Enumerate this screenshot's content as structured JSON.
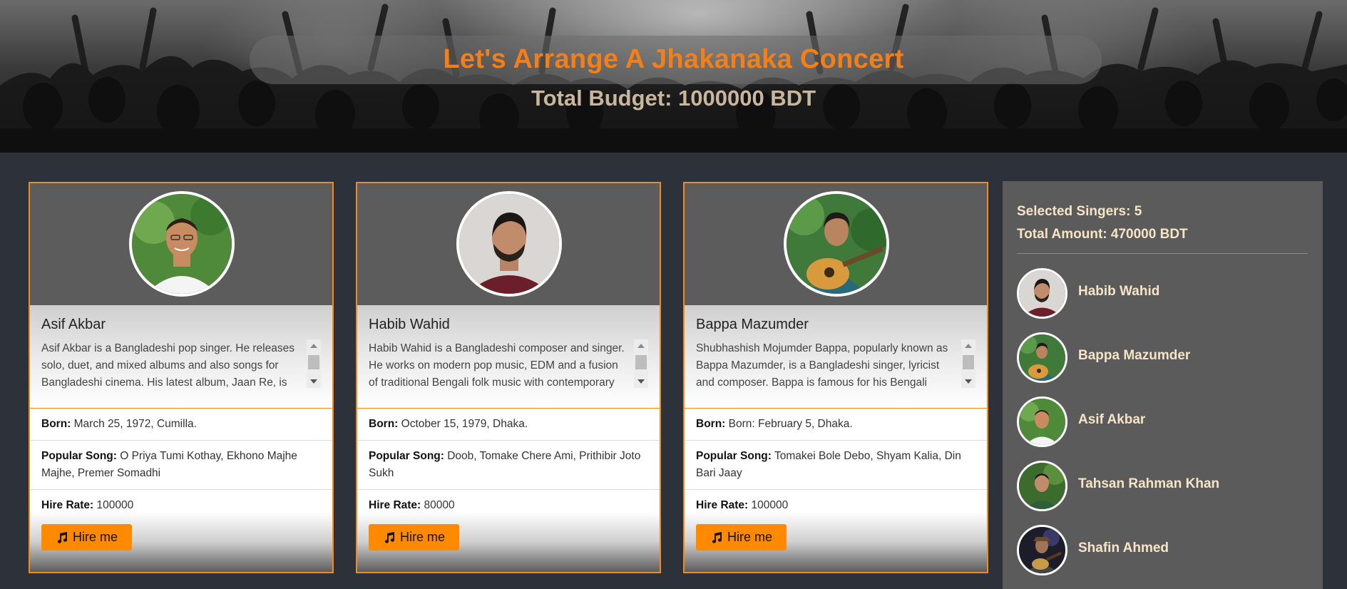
{
  "hero": {
    "title": "Let's Arrange A Jhakanaka Concert",
    "budget": "Total Budget: 1000000 BDT"
  },
  "colors": {
    "accent": "#f47f16",
    "button": "#ff8a00",
    "card_border": "#f28a1e",
    "page_bg": "#2d3139",
    "sidebar_bg": "#5b5b5b",
    "sidebar_text": "#f7e4c6"
  },
  "cards": [
    {
      "name": "Asif Akbar",
      "description": "Asif Akbar is a Bangladeshi pop singer. He releases solo, duet, and mixed albums and also songs for Bangladeshi cinema. His latest album, Jaan Re, is",
      "born_label": "Born:",
      "born": "March 25, 1972, Cumilla.",
      "song_label": "Popular Song:",
      "song": "O Priya Tumi Kothay, Ekhono Majhe Majhe, Premer Somadhi",
      "rate_label": "Hire Rate:",
      "rate": "100000",
      "button": "Hire me",
      "photo_icon": "singer-photo"
    },
    {
      "name": "Habib Wahid",
      "description": "Habib Wahid is a Bangladeshi composer and singer. He works on modern pop music, EDM and a fusion of traditional Bengali folk music with contemporary",
      "born_label": "Born:",
      "born": "October 15, 1979, Dhaka.",
      "song_label": "Popular Song:",
      "song": "Doob, Tomake Chere Ami, Prithibir Joto Sukh",
      "rate_label": "Hire Rate:",
      "rate": "80000",
      "button": "Hire me",
      "photo_icon": "singer-photo"
    },
    {
      "name": "Bappa Mazumder",
      "description": "Shubhashish Mojumder Bappa, popularly known as Bappa Mazumder, is a Bangladeshi singer, lyricist and composer. Bappa is famous for his Bengali",
      "born_label": "Born:",
      "born": "Born: February 5, Dhaka.",
      "song_label": "Popular Song:",
      "song": "Tomakei Bole Debo, Shyam Kalia, Din Bari Jaay",
      "rate_label": "Hire Rate:",
      "rate": "100000",
      "button": "Hire me",
      "photo_icon": "singer-photo"
    }
  ],
  "sidebar": {
    "selected": "Selected Singers: 5",
    "total": "Total Amount: 470000 BDT",
    "items": [
      {
        "name": "Habib Wahid"
      },
      {
        "name": "Bappa Mazumder"
      },
      {
        "name": "Asif Akbar"
      },
      {
        "name": "Tahsan Rahman Khan"
      },
      {
        "name": "Shafin Ahmed"
      }
    ]
  }
}
